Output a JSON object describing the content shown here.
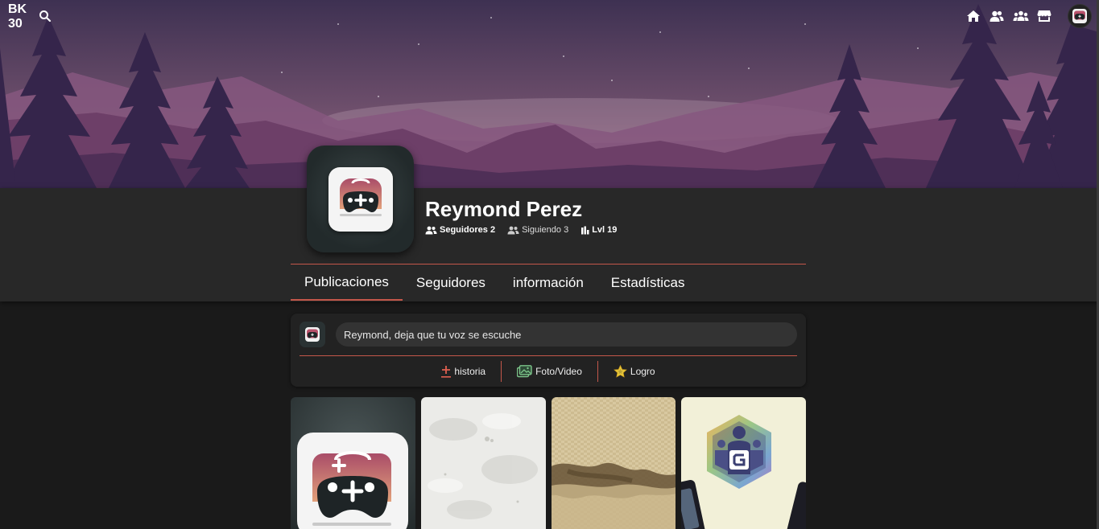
{
  "brand": {
    "line1": "BK",
    "line2": "30"
  },
  "topbar": {
    "search_icon": "search-icon",
    "nav_icons": [
      "home-icon",
      "friends-icon",
      "groups-icon",
      "store-icon"
    ]
  },
  "profile": {
    "name": "Reymond Perez",
    "stats": [
      {
        "icon": "followers-icon",
        "label": "Seguidores 2"
      },
      {
        "icon": "following-icon",
        "label": "Siguiendo 3"
      },
      {
        "icon": "level-icon",
        "label": "Lvl 19"
      }
    ]
  },
  "tabs": [
    {
      "label": "Publicaciones",
      "active": true
    },
    {
      "label": "Seguidores",
      "active": false
    },
    {
      "label": "información",
      "active": false
    },
    {
      "label": "Estadísticas",
      "active": false
    }
  ],
  "composer": {
    "placeholder": "Reymond, deja que tu voz se escuche",
    "actions": [
      {
        "icon": "plus-icon",
        "label": "historia"
      },
      {
        "icon": "photo-icon",
        "label": "Foto/Video"
      },
      {
        "icon": "star-icon",
        "label": "Logro"
      }
    ]
  },
  "colors": {
    "accent": "#c4574a",
    "background": "#1a1a1a",
    "panel": "#282828",
    "sky_top": "#3e3152",
    "sky_bottom": "#8a5e7e"
  },
  "gallery": [
    {
      "name": "gamepad-app-image"
    },
    {
      "name": "white-texture-image"
    },
    {
      "name": "sand-texture-image"
    },
    {
      "name": "guild-badge-image"
    }
  ]
}
